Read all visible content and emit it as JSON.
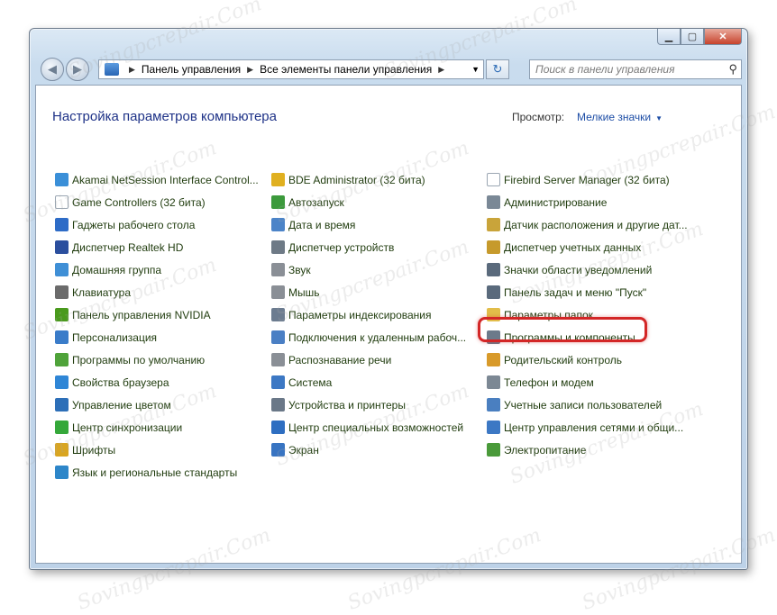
{
  "window": {
    "controls": {
      "minimize": "▁",
      "maximize": "▢",
      "close": "✕"
    }
  },
  "nav": {
    "back": "◀",
    "forward": "▶",
    "breadcrumb": [
      "Панель управления",
      "Все элементы панели управления"
    ],
    "search_placeholder": "Поиск в панели управления"
  },
  "header": {
    "title": "Настройка параметров компьютера",
    "view_label": "Просмотр:",
    "view_value": "Мелкие значки"
  },
  "columns": [
    [
      {
        "label": "Akamai NetSession Interface Control...",
        "icon": "akamai-icon",
        "color": "#3a8fd8"
      },
      {
        "label": "Game Controllers (32 бита)",
        "icon": "document-icon",
        "color": "#ffffff"
      },
      {
        "label": "Гаджеты рабочего стола",
        "icon": "gadgets-icon",
        "color": "#2e6cc7"
      },
      {
        "label": "Диспетчер Realtek HD",
        "icon": "realtek-icon",
        "color": "#2b4f9e"
      },
      {
        "label": "Домашняя группа",
        "icon": "homegroup-icon",
        "color": "#3f8fd6"
      },
      {
        "label": "Клавиатура",
        "icon": "keyboard-icon",
        "color": "#6b6b6b"
      },
      {
        "label": "Панель управления NVIDIA",
        "icon": "nvidia-icon",
        "color": "#4a9a1d"
      },
      {
        "label": "Персонализация",
        "icon": "personalization-icon",
        "color": "#3a7cc9"
      },
      {
        "label": "Программы по умолчанию",
        "icon": "default-programs-icon",
        "color": "#4fa33a"
      },
      {
        "label": "Свойства браузера",
        "icon": "browser-icon",
        "color": "#2f86d6"
      },
      {
        "label": "Управление цветом",
        "icon": "color-management-icon",
        "color": "#2d6fb8"
      },
      {
        "label": "Центр синхронизации",
        "icon": "sync-icon",
        "color": "#35a83a"
      },
      {
        "label": "Шрифты",
        "icon": "fonts-icon",
        "color": "#d9a520"
      },
      {
        "label": "Язык и региональные стандарты",
        "icon": "globe-icon",
        "color": "#2d86c9"
      }
    ],
    [
      {
        "label": "BDE Administrator (32 бита)",
        "icon": "bde-icon",
        "color": "#e0b020"
      },
      {
        "label": "Автозапуск",
        "icon": "autoplay-icon",
        "color": "#3c9a3c"
      },
      {
        "label": "Дата и время",
        "icon": "clock-icon",
        "color": "#4c84c8"
      },
      {
        "label": "Диспетчер устройств",
        "icon": "device-manager-icon",
        "color": "#6e7a86"
      },
      {
        "label": "Звук",
        "icon": "speaker-icon",
        "color": "#8a8f96"
      },
      {
        "label": "Мышь",
        "icon": "mouse-icon",
        "color": "#8a8f96"
      },
      {
        "label": "Параметры индексирования",
        "icon": "indexing-icon",
        "color": "#6c7c90"
      },
      {
        "label": "Подключения к удаленным рабоч...",
        "icon": "remote-desktop-icon",
        "color": "#4a7fc4"
      },
      {
        "label": "Распознавание речи",
        "icon": "microphone-icon",
        "color": "#8a8f96"
      },
      {
        "label": "Система",
        "icon": "system-icon",
        "color": "#3c78c4"
      },
      {
        "label": "Устройства и принтеры",
        "icon": "printer-icon",
        "color": "#6a7888"
      },
      {
        "label": "Центр специальных возможностей",
        "icon": "accessibility-icon",
        "color": "#2e6ec1"
      },
      {
        "label": "Экран",
        "icon": "display-icon",
        "color": "#3874c2"
      }
    ],
    [
      {
        "label": "Firebird Server Manager (32 бита)",
        "icon": "document-icon",
        "color": "#ffffff"
      },
      {
        "label": "Администрирование",
        "icon": "admin-tools-icon",
        "color": "#7a8896"
      },
      {
        "label": "Датчик расположения и другие дат...",
        "icon": "sensor-icon",
        "color": "#c9a43a"
      },
      {
        "label": "Диспетчер учетных данных",
        "icon": "credentials-icon",
        "color": "#c69a2c"
      },
      {
        "label": "Значки области уведомлений",
        "icon": "notification-icon",
        "color": "#5a6a7c"
      },
      {
        "label": "Панель задач и меню \"Пуск\"",
        "icon": "taskbar-icon",
        "color": "#5a6a7c"
      },
      {
        "label": "Параметры папок",
        "icon": "folder-options-icon",
        "color": "#e2bd4a"
      },
      {
        "label": "Программы и компоненты",
        "icon": "programs-features-icon",
        "color": "#6c7a8a"
      },
      {
        "label": "Родительский контроль",
        "icon": "parental-control-icon",
        "color": "#d89a2a"
      },
      {
        "label": "Телефон и модем",
        "icon": "phone-icon",
        "color": "#7c8894"
      },
      {
        "label": "Учетные записи пользователей",
        "icon": "users-icon",
        "color": "#4a7fc0"
      },
      {
        "label": "Центр управления сетями и общи...",
        "icon": "network-icon",
        "color": "#3c78c4"
      },
      {
        "label": "Электропитание",
        "icon": "power-icon",
        "color": "#4a9a3a"
      }
    ]
  ],
  "watermark": "Sovingpcrepair.Com",
  "highlighted_item": "Программы и компоненты"
}
